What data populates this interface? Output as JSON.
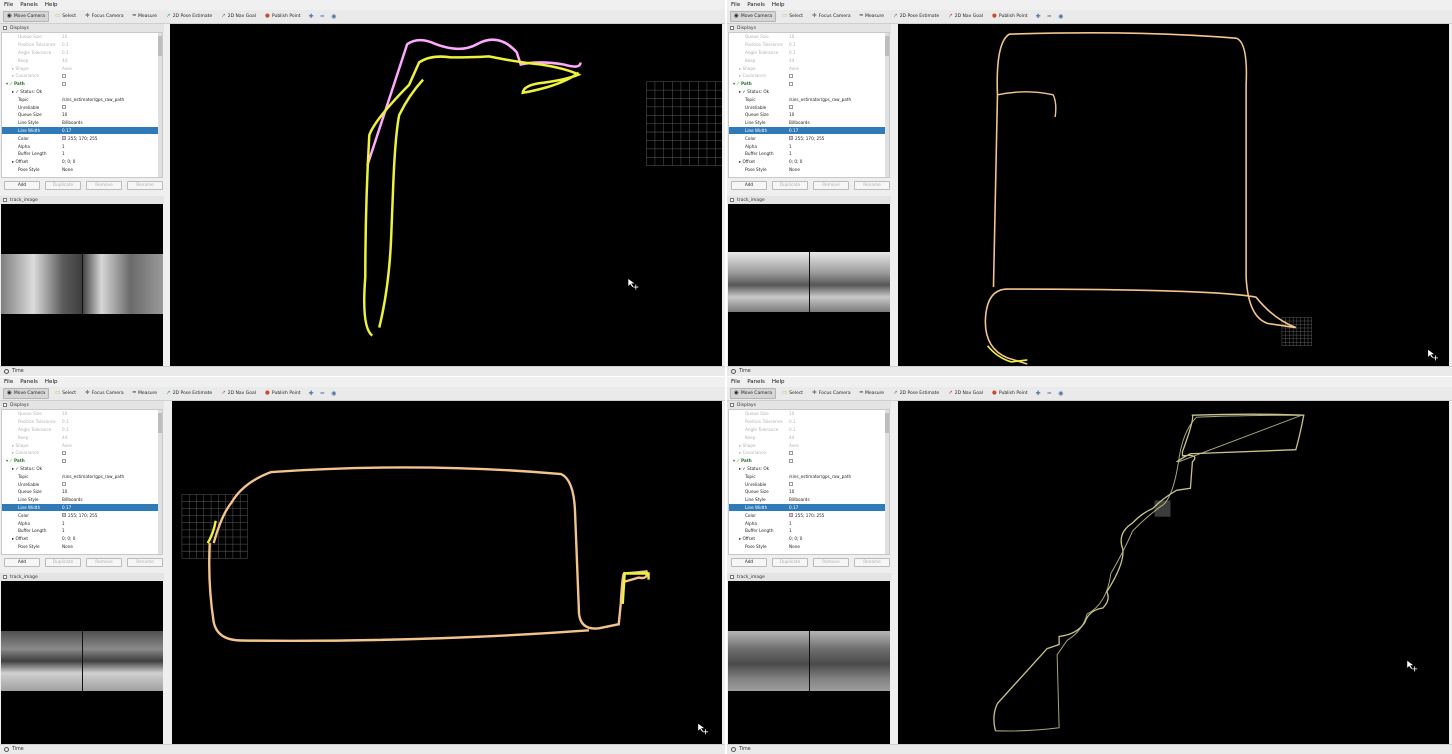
{
  "menu": {
    "file": "File",
    "panels": "Panels",
    "help": "Help"
  },
  "toolbar": {
    "move_camera": "Move Camera",
    "select": "Select",
    "focus_camera": "Focus Camera",
    "measure": "Measure",
    "pose_estimate": "2D Pose Estimate",
    "nav_goal": "2D Nav Goal",
    "publish_point": "Publish Point"
  },
  "displays_title": "Displays",
  "props": {
    "queue_size_faded_label": "Queue Size",
    "queue_size_faded_value": "10",
    "position_tolerance_label": "Position Tolerance",
    "position_tolerance_value": "0.1",
    "angle_tolerance_label": "Angle Tolerance",
    "angle_tolerance_value": "0.1",
    "keep_label": "Keep",
    "keep_value": "44",
    "shape_label": "Shape",
    "shape_value": "Axes",
    "covariance_label": "Covariance",
    "path_label": "Path",
    "status_label": "Status: Ok",
    "topic_label": "Topic",
    "topic_value": "/sins_estimator/gps_raw_path",
    "unreliable_label": "Unreliable",
    "queue_size_label": "Queue Size",
    "queue_size_value": "10",
    "line_style_label": "Line Style",
    "line_style_value": "Billboards",
    "line_width_label": "Line Width",
    "line_width_value": "0.17",
    "color_label": "Color",
    "color_value": "255; 170; 255",
    "alpha_label": "Alpha",
    "alpha_value": "1",
    "buffer_length_label": "Buffer Length",
    "buffer_length_value": "1",
    "offset_label": "Offset",
    "offset_value": "0; 0; 0",
    "pose_style_label": "Pose Style",
    "pose_style_value": "None"
  },
  "buttons": {
    "add": "Add",
    "duplicate": "Duplicate",
    "remove": "Remove",
    "rename": "Rename"
  },
  "track_image_title": "track_image",
  "time_label": "Time",
  "colors": {
    "path_pink": "#ffaaff",
    "path_yellow": "#eef23a",
    "path_peach": "#f3c48e",
    "path_khaki": "#c8c28a",
    "selection": "#2f7ab9"
  }
}
